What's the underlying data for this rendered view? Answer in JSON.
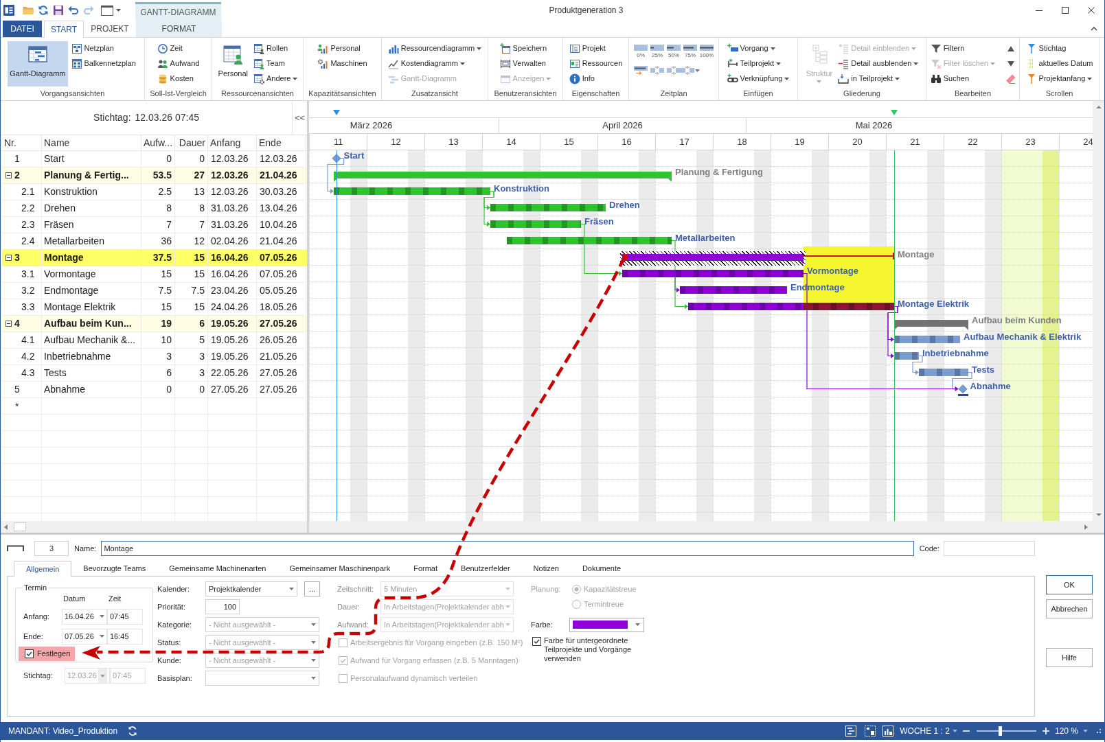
{
  "window": {
    "title": "Produktgeneration 3",
    "context_tab_group": "GANTT-DIAGRAMM"
  },
  "ribbon_tabs": [
    {
      "label": "DATEI",
      "kind": "file",
      "selected": false
    },
    {
      "label": "START",
      "kind": "normal",
      "selected": true
    },
    {
      "label": "PROJEKT",
      "kind": "normal",
      "selected": false
    },
    {
      "label": "FORMAT",
      "kind": "contextual",
      "selected": false
    }
  ],
  "ribbon_groups": [
    {
      "label": "Vorgangsansichten",
      "items": [
        {
          "label": "Gantt-Diagramm",
          "kind": "large",
          "selected": true,
          "disabled": false,
          "dropdown": false
        },
        {
          "label": "Netzplan",
          "kind": "small",
          "selected": false,
          "disabled": false,
          "dropdown": false
        },
        {
          "label": "Balkennetzplan",
          "kind": "small",
          "selected": false,
          "disabled": false,
          "dropdown": false
        }
      ]
    },
    {
      "label": "Soll-Ist-Vergleich",
      "items": [
        {
          "label": "Zeit",
          "kind": "small",
          "disabled": false,
          "dropdown": false
        },
        {
          "label": "Aufwand",
          "kind": "small",
          "disabled": false,
          "dropdown": false
        },
        {
          "label": "Kosten",
          "kind": "small",
          "disabled": false,
          "dropdown": false
        }
      ]
    },
    {
      "label": "Ressourcenansichten",
      "items": [
        {
          "label": "Personal",
          "kind": "large",
          "disabled": false,
          "dropdown": false
        },
        {
          "label": "Rollen",
          "kind": "small",
          "disabled": false,
          "dropdown": false
        },
        {
          "label": "Team",
          "kind": "small",
          "disabled": false,
          "dropdown": false
        },
        {
          "label": "Andere",
          "kind": "small",
          "disabled": false,
          "dropdown": true
        }
      ]
    },
    {
      "label": "Kapazitätsansichten",
      "items": [
        {
          "label": "Personal",
          "kind": "small",
          "disabled": false,
          "dropdown": false
        },
        {
          "label": "Maschinen",
          "kind": "small",
          "disabled": false,
          "dropdown": false
        }
      ]
    },
    {
      "label": "Zusatzansicht",
      "items": [
        {
          "label": "Ressourcendiagramm",
          "kind": "small",
          "disabled": false,
          "dropdown": true
        },
        {
          "label": "Kostendiagramm",
          "kind": "small",
          "disabled": false,
          "dropdown": true
        },
        {
          "label": "Gantt-Diagramm",
          "kind": "small",
          "disabled": true,
          "dropdown": false
        }
      ]
    },
    {
      "label": "Benutzeransichten",
      "items": [
        {
          "label": "Speichern",
          "kind": "small",
          "disabled": false,
          "dropdown": false
        },
        {
          "label": "Verwalten",
          "kind": "small",
          "disabled": false,
          "dropdown": false
        },
        {
          "label": "Anzeigen",
          "kind": "small",
          "disabled": true,
          "dropdown": true
        }
      ]
    },
    {
      "label": "Eigenschaften",
      "items": [
        {
          "label": "Projekt",
          "kind": "small",
          "disabled": false,
          "dropdown": false
        },
        {
          "label": "Ressourcen",
          "kind": "small",
          "disabled": false,
          "dropdown": false
        },
        {
          "label": "Info",
          "kind": "small",
          "disabled": false,
          "dropdown": false
        }
      ]
    },
    {
      "label": "Zeitplan",
      "items": [
        {
          "label": "0%",
          "kind": "mini",
          "disabled": false,
          "dropdown": false
        },
        {
          "label": "25%",
          "kind": "mini",
          "disabled": false,
          "dropdown": false
        },
        {
          "label": "50%",
          "kind": "mini",
          "disabled": false,
          "dropdown": false
        },
        {
          "label": "75%",
          "kind": "mini",
          "disabled": false,
          "dropdown": false
        },
        {
          "label": "100%",
          "kind": "mini",
          "disabled": false,
          "dropdown": false
        },
        {
          "kind": "icon",
          "disabled": false,
          "dropdown": false
        },
        {
          "kind": "icon",
          "disabled": false,
          "dropdown": false
        },
        {
          "kind": "icon",
          "disabled": false,
          "dropdown": false
        },
        {
          "kind": "icon",
          "disabled": false,
          "dropdown": true
        }
      ]
    },
    {
      "label": "Einfügen",
      "items": [
        {
          "label": "Vorgang",
          "kind": "small",
          "disabled": false,
          "dropdown": true
        },
        {
          "label": "Teilprojekt",
          "kind": "small",
          "disabled": false,
          "dropdown": true
        },
        {
          "label": "Verknüpfung",
          "kind": "small",
          "disabled": false,
          "dropdown": true
        }
      ]
    },
    {
      "label": "Gliederung",
      "items": [
        {
          "label": "Struktur",
          "kind": "large",
          "disabled": true,
          "dropdown": true
        },
        {
          "label": "Detail einblenden",
          "kind": "small",
          "disabled": true,
          "dropdown": true
        },
        {
          "label": "Detail ausblenden",
          "kind": "small",
          "disabled": false,
          "dropdown": true
        },
        {
          "label": "in Teilprojekt",
          "kind": "small",
          "disabled": false,
          "dropdown": true
        }
      ]
    },
    {
      "label": "Bearbeiten",
      "items": [
        {
          "label": "Filtern",
          "kind": "small",
          "disabled": false,
          "dropdown": false
        },
        {
          "label": "Filter löschen",
          "kind": "small",
          "disabled": true,
          "dropdown": true
        },
        {
          "label": "Suchen",
          "kind": "small",
          "disabled": false,
          "dropdown": false
        },
        {
          "kind": "icon",
          "disabled": false,
          "dropdown": false
        },
        {
          "kind": "icon",
          "disabled": false,
          "dropdown": false
        },
        {
          "kind": "icon",
          "disabled": false,
          "dropdown": false
        }
      ]
    },
    {
      "label": "Scrollen",
      "items": [
        {
          "label": "Stichtag",
          "kind": "small",
          "disabled": false,
          "dropdown": false
        },
        {
          "label": "aktuelles Datum",
          "kind": "small",
          "disabled": false,
          "dropdown": false
        },
        {
          "label": "Projektanfang",
          "kind": "small",
          "disabled": false,
          "dropdown": true
        }
      ]
    }
  ],
  "task_panel": {
    "stichtag_label": "Stichtag:",
    "stichtag_value": "12.03.26 07:45",
    "collapse_button": "<<",
    "columns": [
      "Nr.",
      "Name",
      "Aufw...",
      "Dauer",
      "Anfang",
      "Ende"
    ],
    "rows": [
      {
        "nr": "1",
        "name": "Start",
        "effort": "0",
        "duration": "0",
        "start": "12.03.26",
        "end": "12.03.26",
        "selected": false
      },
      {
        "nr": "2",
        "name": "Planung & Fertig...",
        "effort": "53.5",
        "duration": "27",
        "start": "12.03.26",
        "end": "21.04.26",
        "selected": false,
        "expanded": true,
        "children": [
          {
            "nr": "2.1",
            "name": "Konstruktion",
            "effort": "2.5",
            "duration": "13",
            "start": "12.03.26",
            "end": "30.03.26",
            "selected": false
          },
          {
            "nr": "2.2",
            "name": "Drehen",
            "effort": "8",
            "duration": "8",
            "start": "31.03.26",
            "end": "13.04.26",
            "selected": false
          },
          {
            "nr": "2.3",
            "name": "Fräsen",
            "effort": "7",
            "duration": "7",
            "start": "31.03.26",
            "end": "10.04.26",
            "selected": false
          },
          {
            "nr": "2.4",
            "name": "Metallarbeiten",
            "effort": "36",
            "duration": "12",
            "start": "02.04.26",
            "end": "21.04.26",
            "selected": false
          }
        ]
      },
      {
        "nr": "3",
        "name": "Montage",
        "effort": "37.5",
        "duration": "15",
        "start": "16.04.26",
        "end": "07.05.26",
        "selected": true,
        "expanded": true,
        "children": [
          {
            "nr": "3.1",
            "name": "Vormontage",
            "effort": "15",
            "duration": "15",
            "start": "16.04.26",
            "end": "07.05.26",
            "selected": false
          },
          {
            "nr": "3.2",
            "name": "Endmontage",
            "effort": "7.5",
            "duration": "7.5",
            "start": "23.04.26",
            "end": "05.05.26",
            "selected": false
          },
          {
            "nr": "3.3",
            "name": "Montage Elektrik",
            "effort": "15",
            "duration": "15",
            "start": "24.04.26",
            "end": "18.05.26",
            "selected": false
          }
        ]
      },
      {
        "nr": "4",
        "name": "Aufbau beim Kun...",
        "effort": "19",
        "duration": "6",
        "start": "19.05.26",
        "end": "27.05.26",
        "selected": false,
        "expanded": true,
        "children": [
          {
            "nr": "4.1",
            "name": "Aufbau Mechanik &...",
            "effort": "10",
            "duration": "5",
            "start": "19.05.26",
            "end": "26.05.26",
            "selected": false
          },
          {
            "nr": "4.2",
            "name": "Inbetriebnahme",
            "effort": "3",
            "duration": "3",
            "start": "19.05.26",
            "end": "21.05.26",
            "selected": false
          },
          {
            "nr": "4.3",
            "name": "Tests",
            "effort": "6",
            "duration": "3",
            "start": "22.05.26",
            "end": "27.05.26",
            "selected": false
          }
        ]
      },
      {
        "nr": "5",
        "name": "Abnahme",
        "effort": "0",
        "duration": "0",
        "start": "27.05.26",
        "end": "27.05.26",
        "selected": false
      }
    ],
    "new_row_marker": "*"
  },
  "gantt": {
    "months": [
      "März 2026",
      "April 2026",
      "Mai 2026"
    ],
    "weeks": [
      {
        "label": "11",
        "highlighted": false
      },
      {
        "label": "12",
        "highlighted": false
      },
      {
        "label": "13",
        "highlighted": false
      },
      {
        "label": "14",
        "highlighted": false
      },
      {
        "label": "15",
        "highlighted": false
      },
      {
        "label": "16",
        "highlighted": false
      },
      {
        "label": "17",
        "highlighted": false
      },
      {
        "label": "18",
        "highlighted": false
      },
      {
        "label": "19",
        "highlighted": false
      },
      {
        "label": "20",
        "highlighted": false
      },
      {
        "label": "21",
        "highlighted": false
      },
      {
        "label": "22",
        "highlighted": false
      },
      {
        "label": "23",
        "highlighted": true
      },
      {
        "label": "24",
        "highlighted": false
      }
    ],
    "markers": [
      {
        "kind": "stichtag",
        "color": "#2f8fe0"
      },
      {
        "kind": "overrun-end",
        "color": "#2ec865"
      }
    ],
    "bars": [
      {
        "label": "Start",
        "kind": "milestone",
        "color": "#7b9cd0",
        "fixed": false,
        "deadline": false
      },
      {
        "label": "Planung & Fertigung",
        "kind": "summary",
        "color": "#2fc42f",
        "fixed": false,
        "deadline": false
      },
      {
        "label": "Konstruktion",
        "kind": "task",
        "color": "#2fc42f",
        "fixed": false,
        "deadline": false
      },
      {
        "label": "Drehen",
        "kind": "task",
        "color": "#2fc42f",
        "fixed": false,
        "deadline": false
      },
      {
        "label": "Fräsen",
        "kind": "task",
        "color": "#2fc42f",
        "fixed": false,
        "deadline": false
      },
      {
        "label": "Metallarbeiten",
        "kind": "task",
        "color": "#2fc42f",
        "fixed": false,
        "deadline": false
      },
      {
        "label": "Montage",
        "kind": "summary",
        "color": "#8c00d8",
        "fixed": true,
        "deadline": false
      },
      {
        "label": "Vormontage",
        "kind": "task",
        "color": "#8c00d8",
        "fixed": false,
        "deadline": false
      },
      {
        "label": "Endmontage",
        "kind": "task",
        "color": "#8c00d8",
        "fixed": false,
        "deadline": false
      },
      {
        "label": "Montage Elektrik",
        "kind": "task",
        "color": "#8c00d8",
        "fixed": false,
        "deadline": false
      },
      {
        "label": "Aufbau beim Kunden",
        "kind": "summary",
        "color": "#737373",
        "fixed": false,
        "deadline": false
      },
      {
        "label": "Aufbau Mechanik & Elektrik",
        "kind": "task",
        "color": "#7b9cd0",
        "fixed": false,
        "deadline": false
      },
      {
        "label": "Inbetriebnahme",
        "kind": "task",
        "color": "#7b9cd0",
        "fixed": false,
        "deadline": false
      },
      {
        "label": "Tests",
        "kind": "task",
        "color": "#7b9cd0",
        "fixed": false,
        "deadline": false
      },
      {
        "label": "Abnahme",
        "kind": "milestone",
        "color": "#7b9cd0",
        "fixed": false,
        "deadline": true
      }
    ]
  },
  "detail": {
    "number": "3",
    "name_label": "Name:",
    "name_value": "Montage",
    "code_label": "Code:",
    "tabs": [
      {
        "label": "Allgemein",
        "selected": true
      },
      {
        "label": "Bevorzugte Teams",
        "selected": false
      },
      {
        "label": "Gemeinsame Machinenarten",
        "selected": false
      },
      {
        "label": "Gemeinsamer Maschinenpark",
        "selected": false
      },
      {
        "label": "Format",
        "selected": false
      },
      {
        "label": "Benutzerfelder",
        "selected": false
      },
      {
        "label": "Notizen",
        "selected": false
      },
      {
        "label": "Dokumente",
        "selected": false
      }
    ],
    "termin": {
      "legend": "Termin",
      "date_header": "Datum",
      "time_header": "Zeit",
      "rows": [
        {
          "label": "Anfang:",
          "date": "16.04.26",
          "time": "07:45"
        },
        {
          "label": "Ende:",
          "date": "07.05.26",
          "time": "16:45"
        }
      ],
      "fix_checkbox": {
        "label": "Festlegen",
        "checked": true,
        "highlighted": true
      }
    },
    "stichtag": {
      "label": "Stichtag:",
      "date": "12.03.26",
      "time": "07:45",
      "disabled": true
    },
    "fields": [
      {
        "label": "Kalender:",
        "kind": "combo",
        "value": "Projektkalender",
        "button": "...",
        "disabled": false
      },
      {
        "label": "Priorität:",
        "kind": "number",
        "value": "100",
        "disabled": false
      },
      {
        "label": "Kategorie:",
        "kind": "combo",
        "placeholder": "- Nicht ausgewählt -",
        "disabled": false
      },
      {
        "label": "Status:",
        "kind": "combo",
        "placeholder": "- Nicht ausgewählt -",
        "disabled": false
      },
      {
        "label": "Kunde:",
        "kind": "combo",
        "placeholder": "- Nicht ausgewählt -",
        "disabled": false
      },
      {
        "label": "Basisplan:",
        "kind": "combo",
        "disabled": false
      }
    ],
    "settings": [
      {
        "label": "Zeitschnitt:",
        "kind": "combo",
        "value": "5 Minuten",
        "disabled": true
      },
      {
        "label": "Dauer:",
        "kind": "combo",
        "value": "In Arbeitstagen(Projektkalender abh",
        "disabled": true
      },
      {
        "label": "Aufwand:",
        "kind": "combo",
        "value": "In Arbeitstagen(Projektkalender abh",
        "disabled": true
      }
    ],
    "options": [
      {
        "label": "Arbeitsergebnis für Vorgang eingeben (z.B. 150 M²)",
        "checked": false,
        "disabled": true
      },
      {
        "label": "Aufwand für Vorgang erfassen (z.B. 5 Manntagen)",
        "checked": true,
        "disabled": true
      },
      {
        "label": "Personalaufwand dynamisch verteilen",
        "checked": false,
        "disabled": true
      }
    ],
    "planning": {
      "label": "Planung:",
      "disabled": true,
      "choices": [
        {
          "label": "Kapazitätstreue",
          "selected": true
        },
        {
          "label": "Termintreue",
          "selected": false
        }
      ]
    },
    "color_field": {
      "label": "Farbe:",
      "color": "#9000d8"
    },
    "inherit_color": {
      "label": "Farbe für untergeordnete Teilprojekte und Vorgänge verwenden",
      "checked": true
    },
    "buttons": [
      {
        "label": "OK",
        "kind": "default"
      },
      {
        "label": "Abbrechen",
        "kind": "normal"
      },
      {
        "label": "Hilfe",
        "kind": "help"
      }
    ]
  },
  "annotations": [
    {
      "kind": "dashed-arrow"
    }
  ],
  "status_bar": {
    "mandant": "MANDANT: Video_Produktion",
    "scale_mode": "WOCHE 1 : 2",
    "zoom_slider": {
      "level": 0.39
    },
    "zoom_value": "120 %"
  }
}
